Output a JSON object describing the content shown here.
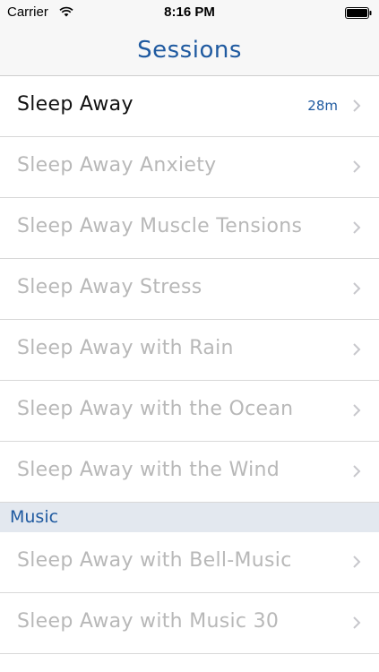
{
  "status_bar": {
    "carrier": "Carrier",
    "time": "8:16 PM"
  },
  "nav": {
    "title": "Sessions"
  },
  "sessions": [
    {
      "label": "Sleep Away",
      "duration": "28m",
      "active": true
    },
    {
      "label": "Sleep Away Anxiety",
      "duration": "",
      "active": false
    },
    {
      "label": "Sleep Away Muscle Tensions",
      "duration": "",
      "active": false
    },
    {
      "label": "Sleep Away Stress",
      "duration": "",
      "active": false
    },
    {
      "label": "Sleep Away with Rain",
      "duration": "",
      "active": false
    },
    {
      "label": "Sleep Away with the Ocean",
      "duration": "",
      "active": false
    },
    {
      "label": "Sleep Away with the Wind",
      "duration": "",
      "active": false
    }
  ],
  "music_section": {
    "title": "Music",
    "items": [
      {
        "label": "Sleep Away with Bell-Music"
      },
      {
        "label": "Sleep Away with Music 30"
      }
    ]
  },
  "colors": {
    "accent": "#1f5aa0",
    "active_text": "#111111",
    "inactive_text": "#b8b8b8",
    "section_bg": "#e3e8ef",
    "chevron": "#c7c7cc"
  },
  "icons": {
    "wifi": "wifi-icon",
    "battery": "battery-icon",
    "chevron": "chevron-right-icon"
  }
}
